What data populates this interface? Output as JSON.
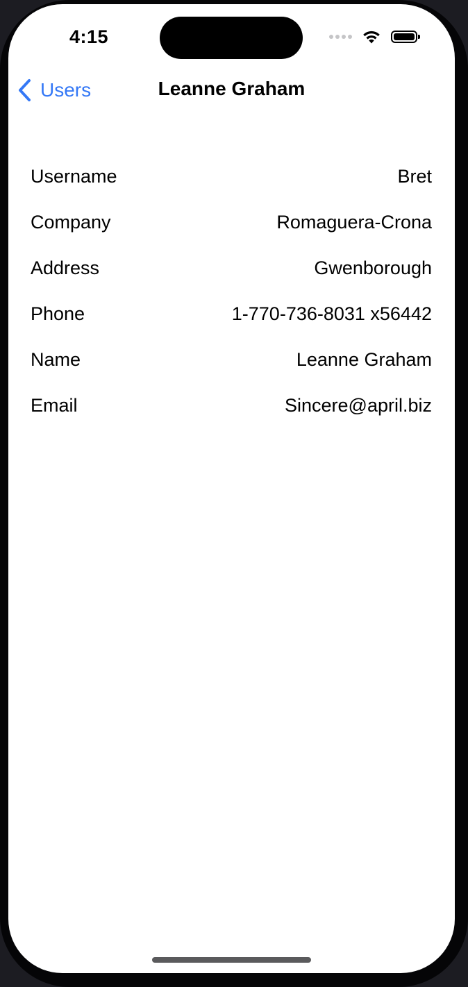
{
  "status_bar": {
    "time": "4:15",
    "icons": [
      "cellular-signal-icon",
      "wifi-icon",
      "battery-icon"
    ]
  },
  "nav": {
    "back_label": "Users",
    "title": "Leanne Graham",
    "accent_color": "#3478f6"
  },
  "details": [
    {
      "label": "Username",
      "value": "Bret"
    },
    {
      "label": "Company",
      "value": "Romaguera-Crona"
    },
    {
      "label": "Address",
      "value": "Gwenborough"
    },
    {
      "label": "Phone",
      "value": "1-770-736-8031 x56442"
    },
    {
      "label": "Name",
      "value": "Leanne Graham"
    },
    {
      "label": "Email",
      "value": "Sincere@april.biz"
    }
  ]
}
